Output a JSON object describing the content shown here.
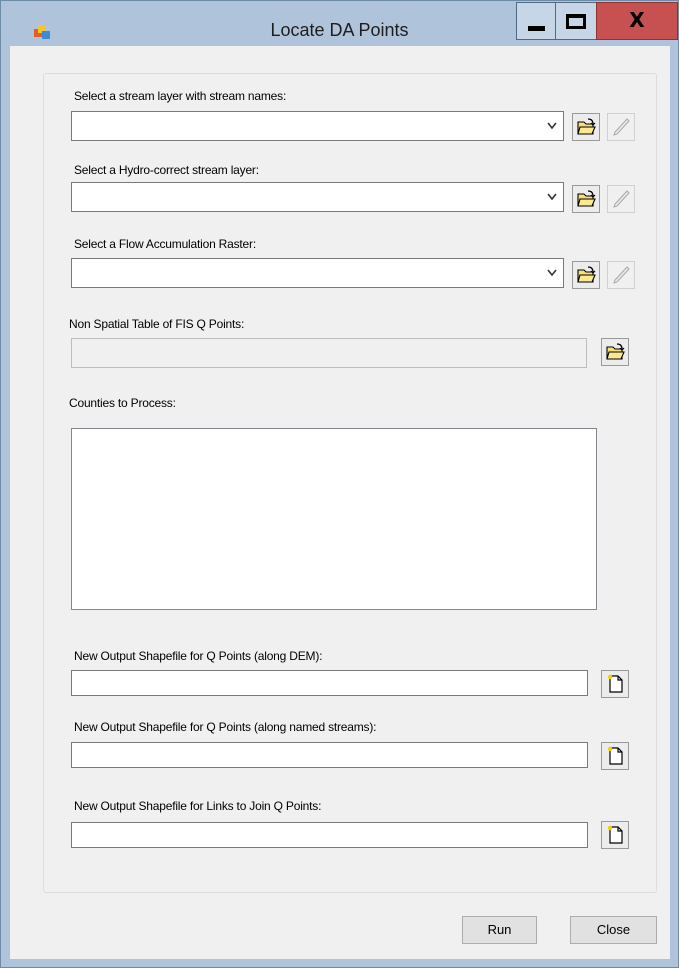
{
  "window": {
    "title": "Locate DA Points",
    "minimize_icon": "minimize-icon",
    "maximize_icon": "maximize-icon",
    "close_glyph": "X"
  },
  "fields": {
    "stream_names": {
      "label": "Select a stream layer with stream names:",
      "value": ""
    },
    "hydro_correct": {
      "label": "Select a Hydro-correct stream layer:",
      "value": ""
    },
    "flow_accumulation": {
      "label": "Select a Flow Accumulation Raster:",
      "value": ""
    },
    "non_spatial_table": {
      "label": "Non Spatial Table of FIS Q Points:",
      "value": ""
    },
    "counties": {
      "label": "Counties to Process:",
      "items": []
    },
    "output_dem": {
      "label": "New Output Shapefile for Q Points (along DEM):",
      "value": ""
    },
    "output_named_streams": {
      "label": "New Output Shapefile for Q Points (along named streams):",
      "value": ""
    },
    "output_links": {
      "label": "New Output Shapefile for Links to Join Q Points:",
      "value": ""
    }
  },
  "buttons": {
    "run": "Run",
    "close": "Close"
  },
  "icons": {
    "browse": "open-folder-icon",
    "edit": "pencil-icon",
    "new_file": "new-file-icon"
  },
  "colors": {
    "titlebar": "#afc4da",
    "close_button": "#c75050",
    "dialog_background": "#f0f0f0"
  }
}
